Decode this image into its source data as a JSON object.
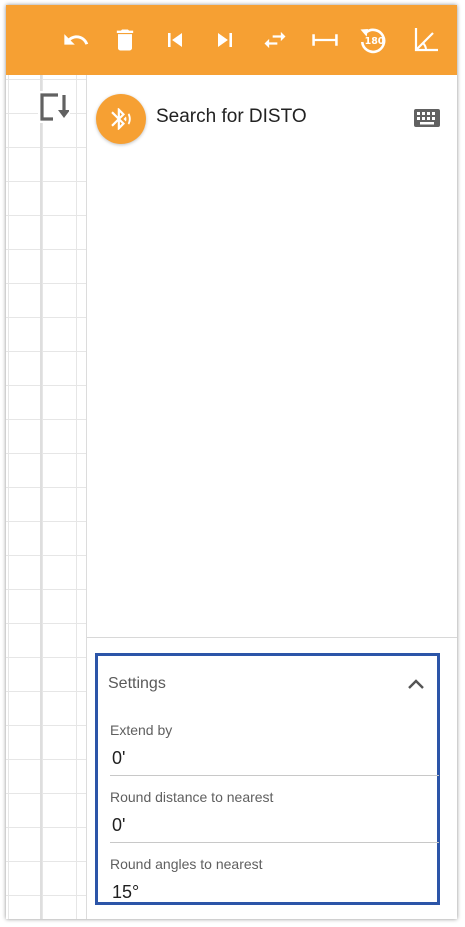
{
  "toolbar": {
    "buttons": [
      {
        "name": "undo-icon"
      },
      {
        "name": "trash-icon"
      },
      {
        "name": "skip-previous-icon"
      },
      {
        "name": "skip-next-icon"
      },
      {
        "name": "swap-icon"
      },
      {
        "name": "dimension-icon"
      },
      {
        "name": "rotate-180-icon",
        "text": "180"
      },
      {
        "name": "angle-icon"
      }
    ],
    "color": "#f6a033"
  },
  "bluetooth": {
    "label": "Search for DISTO",
    "icon": "bluetooth-searching-icon"
  },
  "settings": {
    "title": "Settings",
    "fields": [
      {
        "label": "Extend by",
        "value": "0'"
      },
      {
        "label": "Round distance to nearest",
        "value": "0'"
      },
      {
        "label": "Round angles to nearest",
        "value": "15°"
      }
    ],
    "border_color": "#2c55a8"
  }
}
